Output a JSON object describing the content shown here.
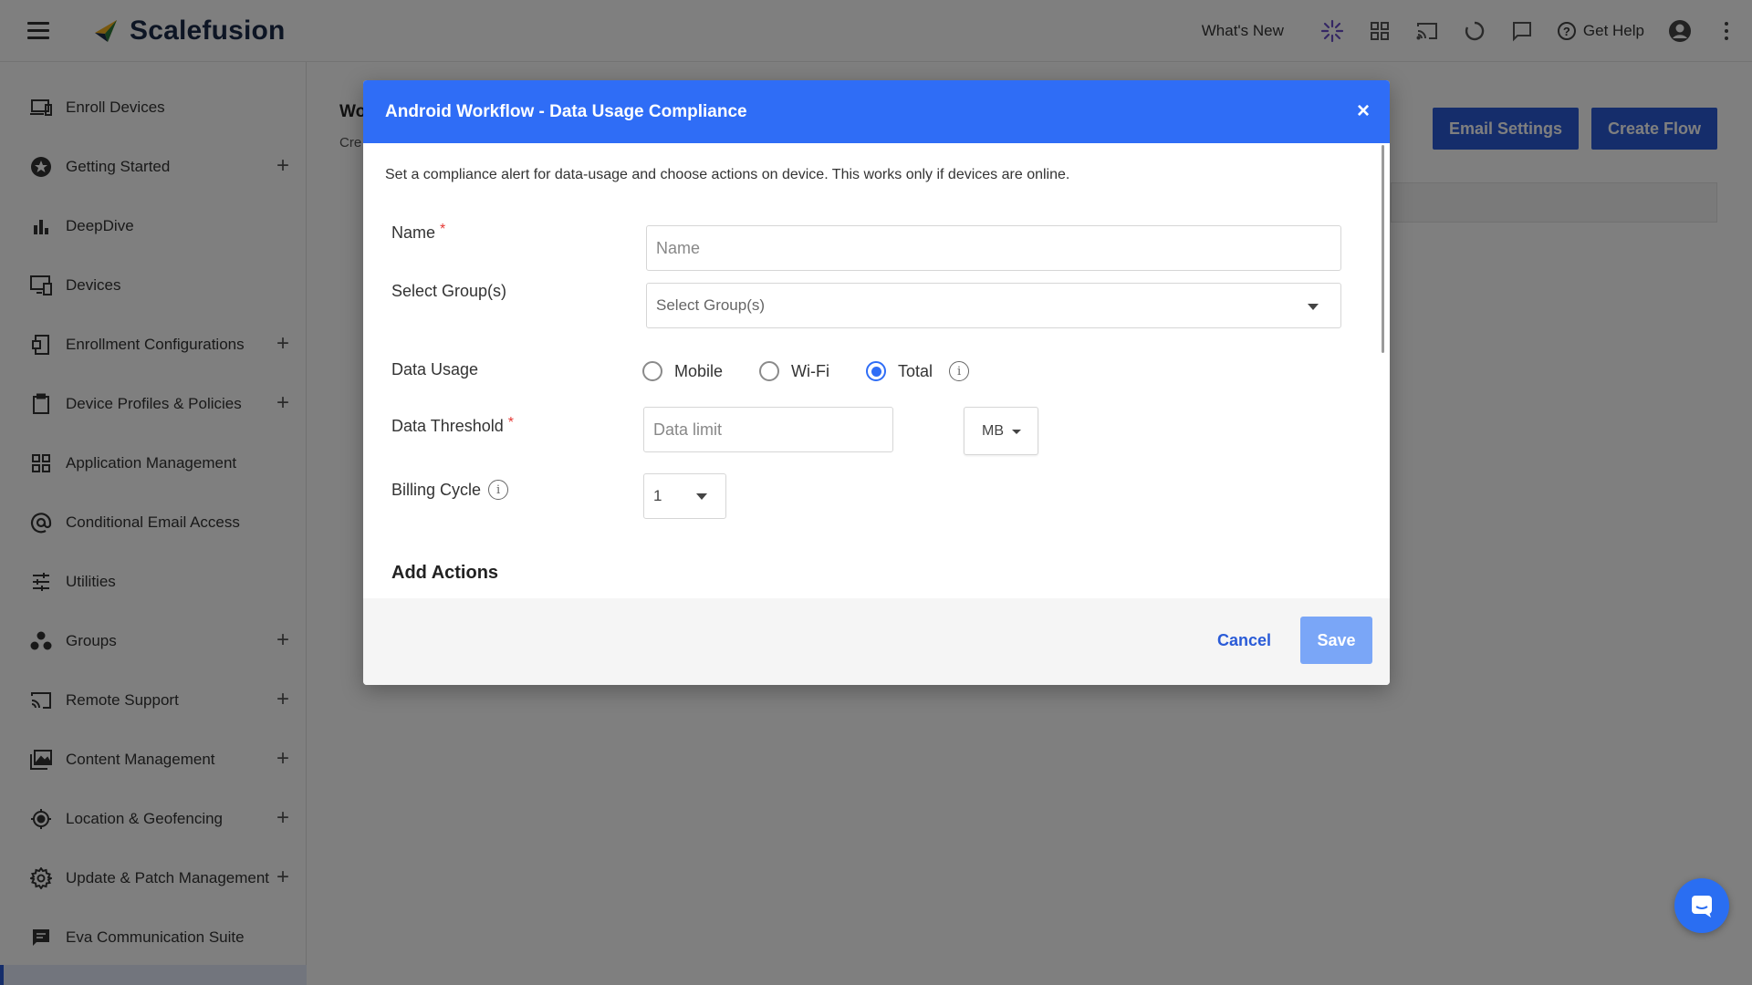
{
  "app": {
    "name": "Scalefusion"
  },
  "topbar": {
    "whats_new": "What's New",
    "get_help": "Get Help"
  },
  "sidebar": {
    "items": [
      {
        "label": "Enroll Devices",
        "icon": "enroll-devices-icon",
        "expandable": false
      },
      {
        "label": "Getting Started",
        "icon": "star-icon",
        "expandable": true
      },
      {
        "label": "DeepDive",
        "icon": "bar-chart-icon",
        "expandable": false
      },
      {
        "label": "Devices",
        "icon": "devices-icon",
        "expandable": false
      },
      {
        "label": "Enrollment Configurations",
        "icon": "enrollment-config-icon",
        "expandable": true
      },
      {
        "label": "Device Profiles & Policies",
        "icon": "clipboard-icon",
        "expandable": true
      },
      {
        "label": "Application Management",
        "icon": "apps-grid-icon",
        "expandable": false
      },
      {
        "label": "Conditional Email Access",
        "icon": "at-sign-icon",
        "expandable": false
      },
      {
        "label": "Utilities",
        "icon": "sliders-icon",
        "expandable": false
      },
      {
        "label": "Groups",
        "icon": "groups-icon",
        "expandable": true
      },
      {
        "label": "Remote Support",
        "icon": "cast-icon",
        "expandable": true
      },
      {
        "label": "Content Management",
        "icon": "image-library-icon",
        "expandable": true
      },
      {
        "label": "Location & Geofencing",
        "icon": "location-target-icon",
        "expandable": true
      },
      {
        "label": "Update & Patch Management",
        "icon": "gear-icon",
        "expandable": true
      },
      {
        "label": "Eva Communication Suite",
        "icon": "chat-icon",
        "expandable": false
      }
    ]
  },
  "page": {
    "title_partial": "Wo",
    "subtitle_partial": "Cre",
    "email_settings": "Email Settings",
    "create_flow": "Create Flow"
  },
  "modal": {
    "title": "Android Workflow - Data Usage Compliance",
    "close": "×",
    "description": "Set a compliance alert for data-usage and choose actions on device. This works only if devices are online.",
    "name_label": "Name",
    "required_mark": "*",
    "name_placeholder": "Name",
    "groups_label": "Select Group(s)",
    "groups_placeholder": "Select Group(s)",
    "data_usage_label": "Data Usage",
    "data_usage_options": [
      "Mobile",
      "Wi-Fi",
      "Total"
    ],
    "data_usage_selected": "Total",
    "threshold_label": "Data Threshold",
    "threshold_placeholder": "Data limit",
    "threshold_unit": "MB",
    "billing_label": "Billing Cycle",
    "billing_value": "1",
    "add_actions": "Add Actions",
    "cancel": "Cancel",
    "save": "Save"
  },
  "colors": {
    "primary": "#2f6df6",
    "header": "#2f6df6",
    "save_disabled": "#7aa6f7",
    "required": "#e53935"
  }
}
